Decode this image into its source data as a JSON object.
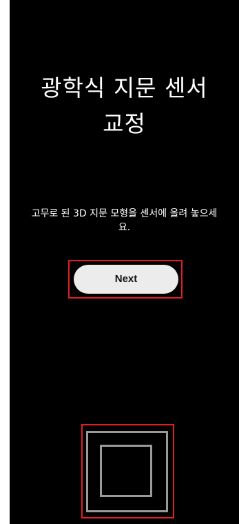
{
  "title": {
    "line1": "광학식 지문 센서",
    "line2": "교정"
  },
  "instruction": {
    "line1": "고무로 된 3D 지문 모형을 센서에 올려 놓으세",
    "line2": "요."
  },
  "next_button": {
    "label": "Next"
  },
  "sensor": {
    "icon": "fingerprint-sensor-square-icon"
  },
  "colors": {
    "background": "#000000",
    "text": "#ffffff",
    "button_bg": "#ececec",
    "highlight": "#e02020",
    "sensor_outline": "#9a9a9a"
  }
}
